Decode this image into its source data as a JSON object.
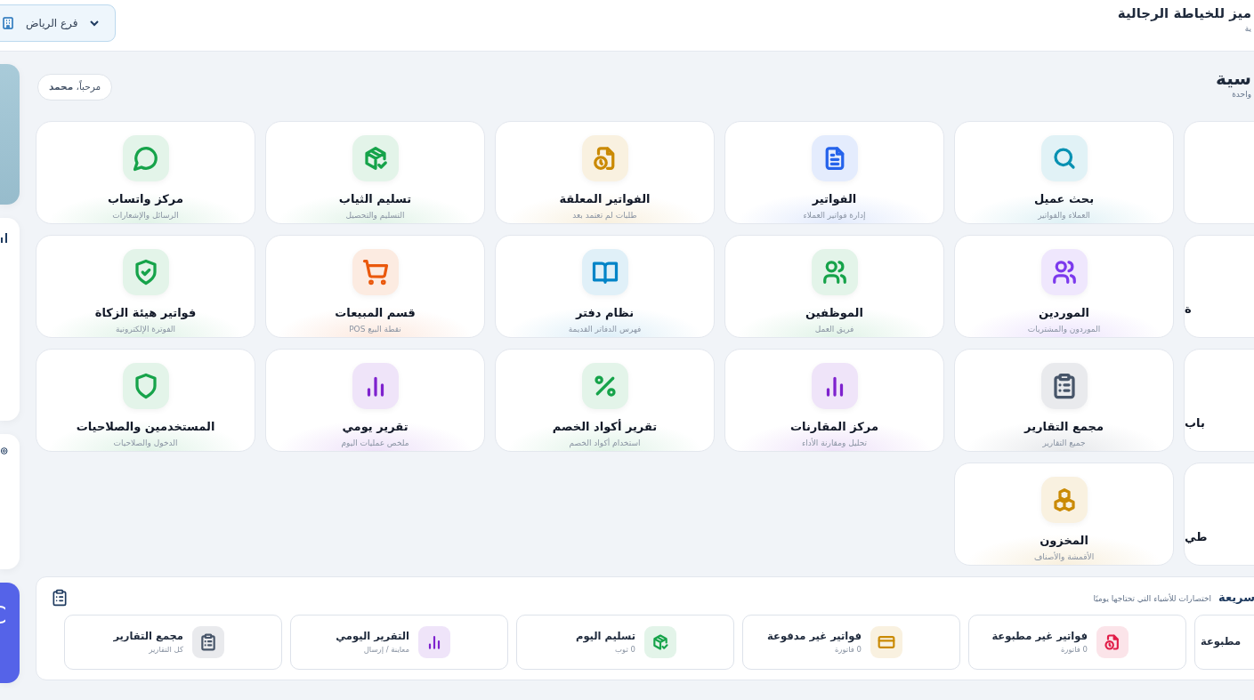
{
  "header": {
    "title": "ميز للخياطة الرجالية",
    "subtitle": "ية",
    "branch": "فرع الرياض"
  },
  "section": {
    "title": "سية",
    "subtitle": "واحدة",
    "welcome": "مرحباً، **محمد**"
  },
  "modules": [
    {
      "kind": "clipped"
    },
    {
      "kind": "search",
      "title": "بحث عميل",
      "subtitle": "العملاء والفواتير",
      "color": "#0891b2"
    },
    {
      "kind": "document",
      "title": "الفواتير",
      "subtitle": "إدارة فواتير العملاء",
      "color": "#2563eb"
    },
    {
      "kind": "file-clock",
      "title": "الفواتير المعلقة",
      "subtitle": "طلبات لم تعتمد بعد",
      "color": "#ca8a04"
    },
    {
      "kind": "package-check",
      "title": "تسليم الثياب",
      "subtitle": "التسليم والتحصيل",
      "color": "#16a34a"
    },
    {
      "kind": "chat",
      "title": "مركز واتساب",
      "subtitle": "الرسائل والإشعارات",
      "color": "#16a34a"
    },
    {
      "kind": "clipped",
      "title": "ة"
    },
    {
      "kind": "users",
      "title": "الموردين",
      "subtitle": "الموردون والمشتريات",
      "color": "#7c3aed"
    },
    {
      "kind": "users",
      "title": "الموظفين",
      "subtitle": "فريق العمل",
      "color": "#16a34a"
    },
    {
      "kind": "book",
      "title": "نظام دفتر",
      "subtitle": "فهرس الدفاتر القديمة",
      "color": "#0284c7"
    },
    {
      "kind": "cart",
      "title": "قسم المبيعات",
      "subtitle": "نقطة البيع POS",
      "color": "#ea580c"
    },
    {
      "kind": "shield-check",
      "title": "فواتير هيئة الزكاة",
      "subtitle": "الفوترة الإلكترونية",
      "color": "#16a34a"
    },
    {
      "kind": "clipped",
      "title": "باب"
    },
    {
      "kind": "clipboard",
      "title": "مجمع التقارير",
      "subtitle": "جميع التقارير",
      "color": "#475569"
    },
    {
      "kind": "bars",
      "title": "مركز المقارنات",
      "subtitle": "تحليل ومقارنة الأداء",
      "color": "#7e22ce"
    },
    {
      "kind": "percent",
      "title": "تقرير أكواد الخصم",
      "subtitle": "استخدام أكواد الخصم",
      "color": "#16a34a"
    },
    {
      "kind": "bars",
      "title": "تقرير يومي",
      "subtitle": "ملخص عمليات اليوم",
      "color": "#7e22ce"
    },
    {
      "kind": "shield",
      "title": "المستخدمين والصلاحيات",
      "subtitle": "الدخول والصلاحيات",
      "color": "#16a34a"
    },
    {
      "kind": "clipped",
      "title": "طي"
    },
    {
      "kind": "cubes",
      "title": "المخزون",
      "subtitle": "الأقمشة والأصناف",
      "color": "#ca8a04"
    }
  ],
  "quick": {
    "title": "سريعة",
    "subtitle": "اختصارات للأشياء التي تحتاجها يوميًا",
    "items": [
      {
        "kind": "clipped",
        "title": "مطبوعة"
      },
      {
        "kind": "file-clock",
        "title": "فواتير غير مطبوعة",
        "subtitle": "0 فاتورة",
        "color": "#e11d48"
      },
      {
        "kind": "credit-card",
        "title": "فواتير غير مدفوعة",
        "subtitle": "0 فاتورة",
        "color": "#ca8a04"
      },
      {
        "kind": "package-check",
        "title": "تسليم اليوم",
        "subtitle": "0 ثوب",
        "color": "#16a34a"
      },
      {
        "kind": "bars",
        "title": "التقرير اليومي",
        "subtitle": "معاينة / إرسال",
        "color": "#7e22ce"
      },
      {
        "kind": "clipboard",
        "title": "مجمع التقارير",
        "subtitle": "كل التقارير",
        "color": "#475569"
      }
    ]
  }
}
